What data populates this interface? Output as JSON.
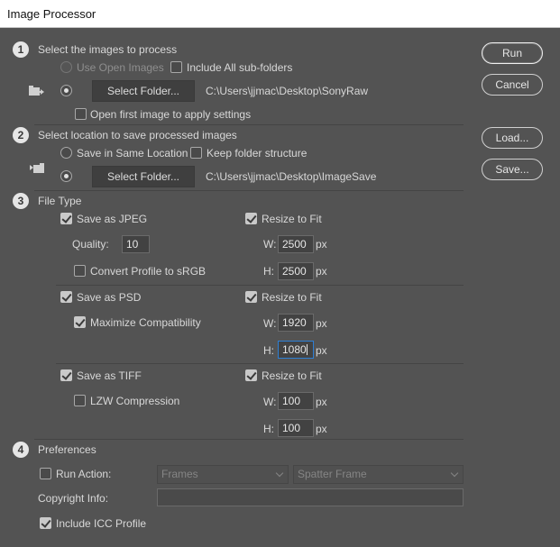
{
  "window": {
    "title": "Image Processor"
  },
  "buttons": {
    "run": "Run",
    "cancel": "Cancel",
    "load": "Load...",
    "save": "Save..."
  },
  "section1": {
    "number": "1",
    "title": "Select the images to process",
    "use_open_images": "Use Open Images",
    "include_subfolders": "Include All sub-folders",
    "select_folder": "Select Folder...",
    "folder_path": "C:\\Users\\jjmac\\Desktop\\SonyRaw",
    "open_first_image": "Open first image to apply settings"
  },
  "section2": {
    "number": "2",
    "title": "Select location to save processed images",
    "save_same_location": "Save in Same Location",
    "keep_folder_structure": "Keep folder structure",
    "select_folder": "Select Folder...",
    "folder_path": "C:\\Users\\jjmac\\Desktop\\ImageSave"
  },
  "section3": {
    "number": "3",
    "title": "File Type",
    "jpeg": {
      "label": "Save as JPEG",
      "resize_label": "Resize to Fit",
      "quality_label": "Quality:",
      "quality_value": "10",
      "convert_profile": "Convert Profile to sRGB",
      "w_label": "W:",
      "w_value": "2500",
      "h_label": "H:",
      "h_value": "2500",
      "unit": "px"
    },
    "psd": {
      "label": "Save as PSD",
      "resize_label": "Resize to Fit",
      "maximize": "Maximize Compatibility",
      "w_label": "W:",
      "w_value": "1920",
      "h_label": "H:",
      "h_value": "1080",
      "unit": "px"
    },
    "tiff": {
      "label": "Save as TIFF",
      "resize_label": "Resize to Fit",
      "lzw": "LZW Compression",
      "w_label": "W:",
      "w_value": "100",
      "h_label": "H:",
      "h_value": "100",
      "unit": "px"
    }
  },
  "section4": {
    "number": "4",
    "title": "Preferences",
    "run_action": "Run Action:",
    "action_set": "Frames",
    "action_name": "Spatter Frame",
    "copyright_label": "Copyright Info:",
    "copyright_value": "",
    "include_icc": "Include ICC Profile"
  },
  "colors": {
    "panel": "#535353",
    "focus_border": "#2d7fd5"
  },
  "icons": {
    "source_folder": "folder-to-image-icon",
    "dest_folder": "image-to-folder-icon"
  }
}
